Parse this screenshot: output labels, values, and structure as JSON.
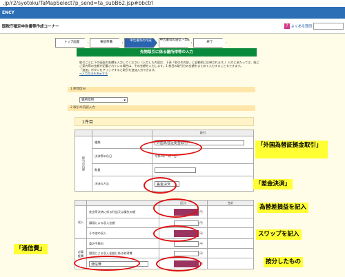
{
  "browser": {
    "url": ".jp/r2/syotoku/TaMapSelect?p_send=ta_subB62.jsp#bbctrl"
  },
  "app": {
    "bar_text": "ENCY",
    "title": "確定申告書等作成コーナー",
    "title_prefix": "国税庁",
    "help_label": "よくある質問"
  },
  "steps": [
    {
      "label": "トップ画面",
      "active": false
    },
    {
      "label": "事前準備",
      "active": false
    },
    {
      "label": "申告書等の作成",
      "active": true
    },
    {
      "label": "申告書等の送信・印刷",
      "active": false
    },
    {
      "label": "終了",
      "active": false
    }
  ],
  "page_title": "先物取引に係る雑所得等の入力",
  "instructions": "取引ごとに下の画面の各欄を入力してください（入力した内容は、下表「取引の内訳」に自動的に反映されます。）入力にあたっては、既にご案内等の金額が記載されている場合は、その金額を入力します。1 枚目の取引分の金額をまとめて入力することもできます。",
  "instructions2": "「追加」ボタンをクリックすると取引を追加入力できます。",
  "instructions_link": "→入力方法を表示する",
  "sections": {
    "s1": "1 所得区分",
    "s2": "2 取引の内訳入力"
  },
  "income_type_select": "雑所得用",
  "item_heading": "1件目",
  "table1": {
    "header": "取引",
    "group_label": "取引の内容",
    "rows": [
      {
        "label": "種類",
        "value": "外国為替証拠金取引"
      },
      {
        "label": "決済等年月日",
        "value": "令和2年　月　日"
      },
      {
        "label": "数量",
        "value": ""
      },
      {
        "label": "決済の方法",
        "value": "差金決済"
      }
    ]
  },
  "table2": {
    "col_headers": [
      "",
      "",
      "区分",
      "合計"
    ],
    "group1": "収入",
    "group2": "必要経費",
    "rows": [
      {
        "label": "差金等決済に係る利益又は損失の額",
        "unit": "円"
      },
      {
        "label": "譲渡による収入金額",
        "unit": "円"
      },
      {
        "label": "その他の収入",
        "unit": "円"
      },
      {
        "label": "委託手数料",
        "unit": "円"
      },
      {
        "label": "譲渡による収入金額に係る取得費",
        "unit": "円"
      },
      {
        "label": "通信費",
        "unit": "円"
      }
    ]
  },
  "callouts": {
    "c1": "「外国為替証拠金取引」",
    "c2": "「差金決済」",
    "c3": "為替差損益を記入",
    "c4": "スワップを記入",
    "c5": "「通信費」",
    "c6": "按分したもの"
  }
}
